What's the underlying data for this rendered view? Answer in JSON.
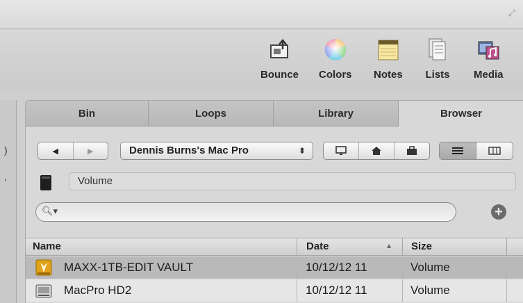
{
  "toolbar": {
    "buttons": [
      {
        "label": "Bounce",
        "icon": "bounce-icon"
      },
      {
        "label": "Colors",
        "icon": "color-wheel-icon"
      },
      {
        "label": "Notes",
        "icon": "notepad-icon"
      },
      {
        "label": "Lists",
        "icon": "lists-icon"
      },
      {
        "label": "Media",
        "icon": "media-icon"
      }
    ]
  },
  "tabs": [
    {
      "label": "Bin",
      "active": false
    },
    {
      "label": "Loops",
      "active": false
    },
    {
      "label": "Library",
      "active": false
    },
    {
      "label": "Browser",
      "active": true
    }
  ],
  "browser": {
    "source": "Dennis Burns's Mac Pro",
    "path": "Volume",
    "search_placeholder": ""
  },
  "table": {
    "columns": {
      "name": "Name",
      "date": "Date",
      "size": "Size"
    },
    "sort_column": "Date",
    "rows": [
      {
        "name": "MAXX-1TB-EDIT VAULT",
        "date": "10/12/12 11",
        "size": "Volume",
        "selected": true,
        "icon": "external-drive-icon"
      },
      {
        "name": "MacPro HD2",
        "date": "10/12/12 11",
        "size": "Volume",
        "selected": false,
        "icon": "internal-drive-icon"
      }
    ]
  },
  "colors": {
    "selected_row": "#b9b9b9",
    "background": "#cfcfcf"
  }
}
